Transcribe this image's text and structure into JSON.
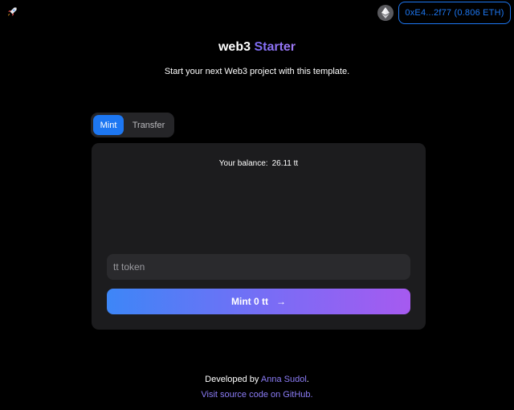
{
  "header": {
    "logo_icon": "rocket-icon",
    "network_icon": "ethereum-icon",
    "wallet_label": "0xE4...2f77 (0.806 ETH)"
  },
  "hero": {
    "title_part1": "web3",
    "title_part2": "Starter",
    "subtitle": "Start your next Web3 project with this template."
  },
  "tabs": [
    {
      "label": "Mint",
      "active": true
    },
    {
      "label": "Transfer",
      "active": false
    }
  ],
  "card": {
    "balance_label": "Your balance:",
    "balance_value": "26.11 tt",
    "input_placeholder": "tt token",
    "input_value": "",
    "mint_button_label": "Mint 0 tt",
    "mint_button_icon": "arrow-right-icon"
  },
  "footer": {
    "developed_by": "Developed by",
    "author": "Anna Sudol",
    "period": ".",
    "source_link": "Visit source code on GitHub."
  },
  "colors": {
    "background": "#000000",
    "accent_blue": "#1d77f2",
    "accent_purple": "#8b7cf6",
    "card": "#1c1c1e"
  }
}
